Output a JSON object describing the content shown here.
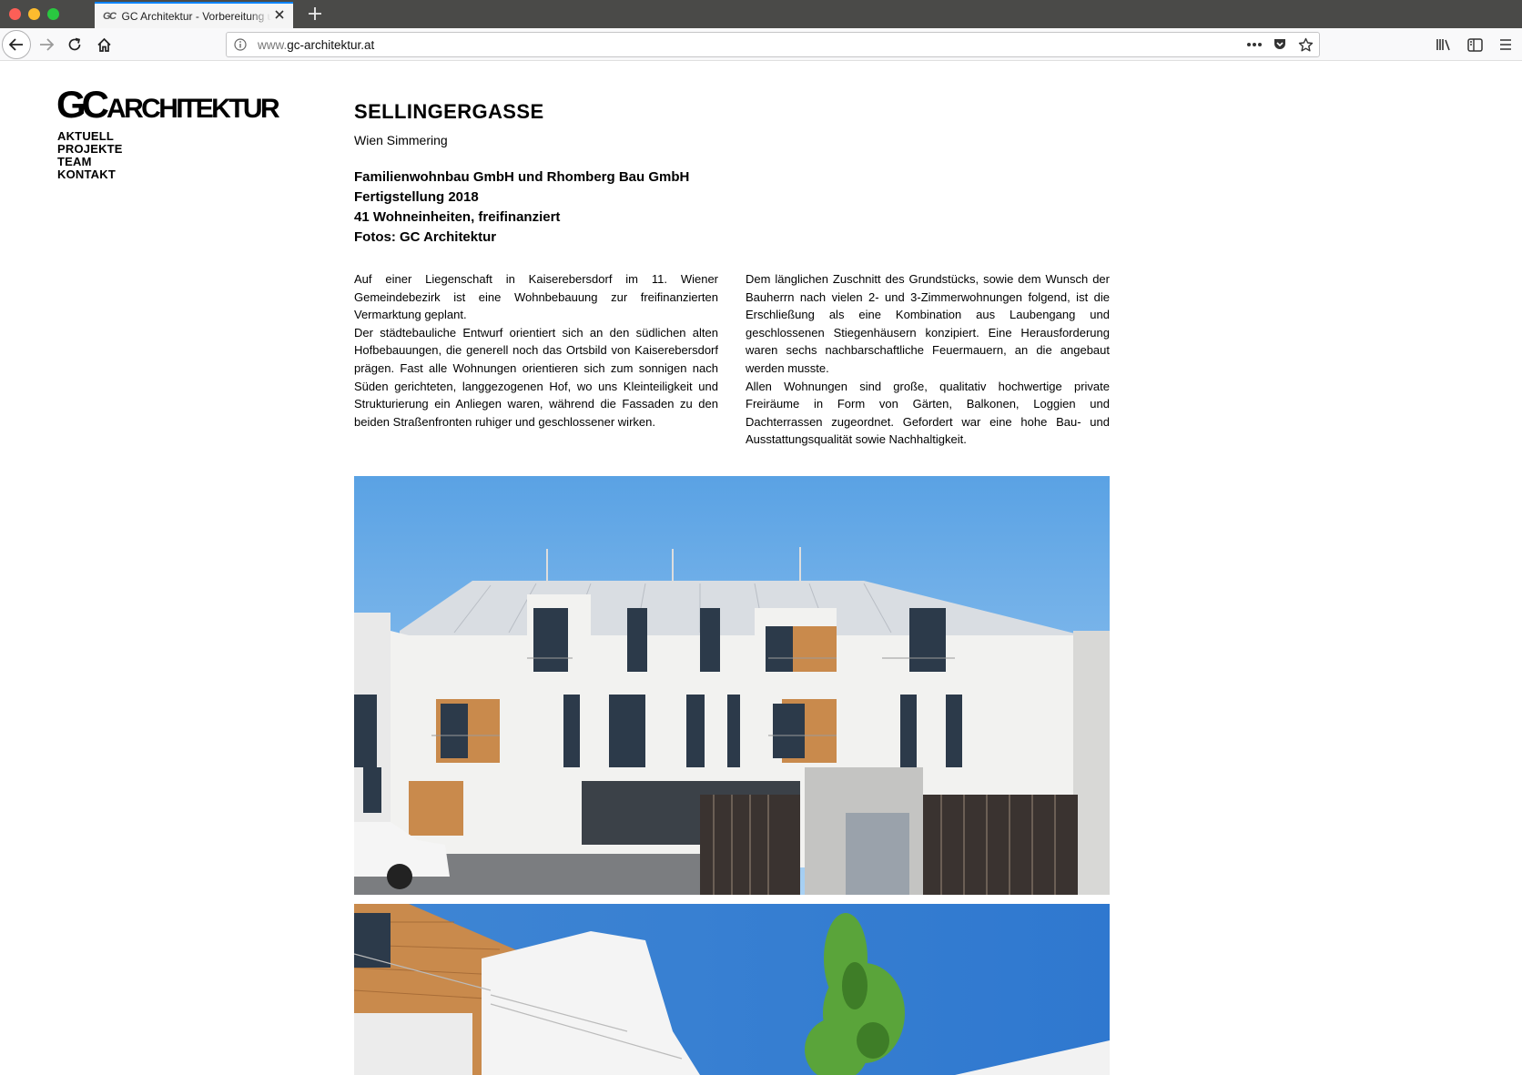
{
  "browser": {
    "tab_title": "GC Architektur - Vorbereitung und Planung",
    "tab_favicon": "GC",
    "url_prefix": "www.",
    "url_domain": "gc-architektur.at",
    "icons": [
      "back-icon",
      "forward-icon",
      "reload-icon",
      "home-icon",
      "info-icon",
      "more-icon",
      "pocket-icon",
      "bookmark-star-icon",
      "library-icon",
      "sidebar-icon",
      "menu-icon",
      "close-icon",
      "new-tab-icon"
    ]
  },
  "logo": {
    "gc": "GC",
    "rest": "ARCHITEKTUR"
  },
  "nav": {
    "items": [
      "AKTUELL",
      "PROJEKTE",
      "TEAM",
      "KONTAKT"
    ]
  },
  "project": {
    "title": "SELLINGERGASSE",
    "location": "Wien Simmering",
    "facts": [
      "Familienwohnbau GmbH und Rhomberg Bau GmbH",
      "Fertigstellung 2018",
      "41 Wohneinheiten, freifinanziert",
      "Fotos: GC Architektur"
    ],
    "col1": [
      "Auf einer Liegenschaft in Kaiserebersdorf im 11. Wiener Gemeindebezirk ist eine Wohnbebauung zur freifinanzierten Vermarktung geplant.",
      "Der städtebauliche Entwurf orientiert sich an den südlichen alten Hofbebauungen, die generell noch das Ortsbild von Kaiserebersdorf prägen. Fast alle Wohnungen orientieren sich zum sonnigen nach Süden gerichteten, langgezogenen Hof, wo uns Kleinteiligkeit und Strukturierung ein Anliegen waren, während die Fassaden zu den beiden Straßenfronten ruhiger und geschlossener wirken."
    ],
    "col2": [
      "Dem länglichen Zuschnitt des Grundstücks, sowie dem Wunsch der Bauherrn nach vielen 2- und 3-Zimmerwohnungen folgend, ist die Erschließung als eine Kombination aus Laubengang und geschlossenen Stiegenhäusern konzipiert. Eine Herausforderung waren sechs nachbarschaftliche Feuermauern, an die angebaut werden musste.",
      "Allen Wohnungen sind große, qualitativ hochwertige private Freiräume in Form von Gärten, Balkonen, Loggien und Dachterrassen zugeordnet. Gefordert war eine hohe Bau- und Ausstattungsqualität sowie Nachhaltigkeit."
    ]
  },
  "colors": {
    "tab_accent": "#0a84ff",
    "sky": "#6aabe6",
    "facade": "#f2f2f0",
    "wood": "#c98a4c"
  }
}
